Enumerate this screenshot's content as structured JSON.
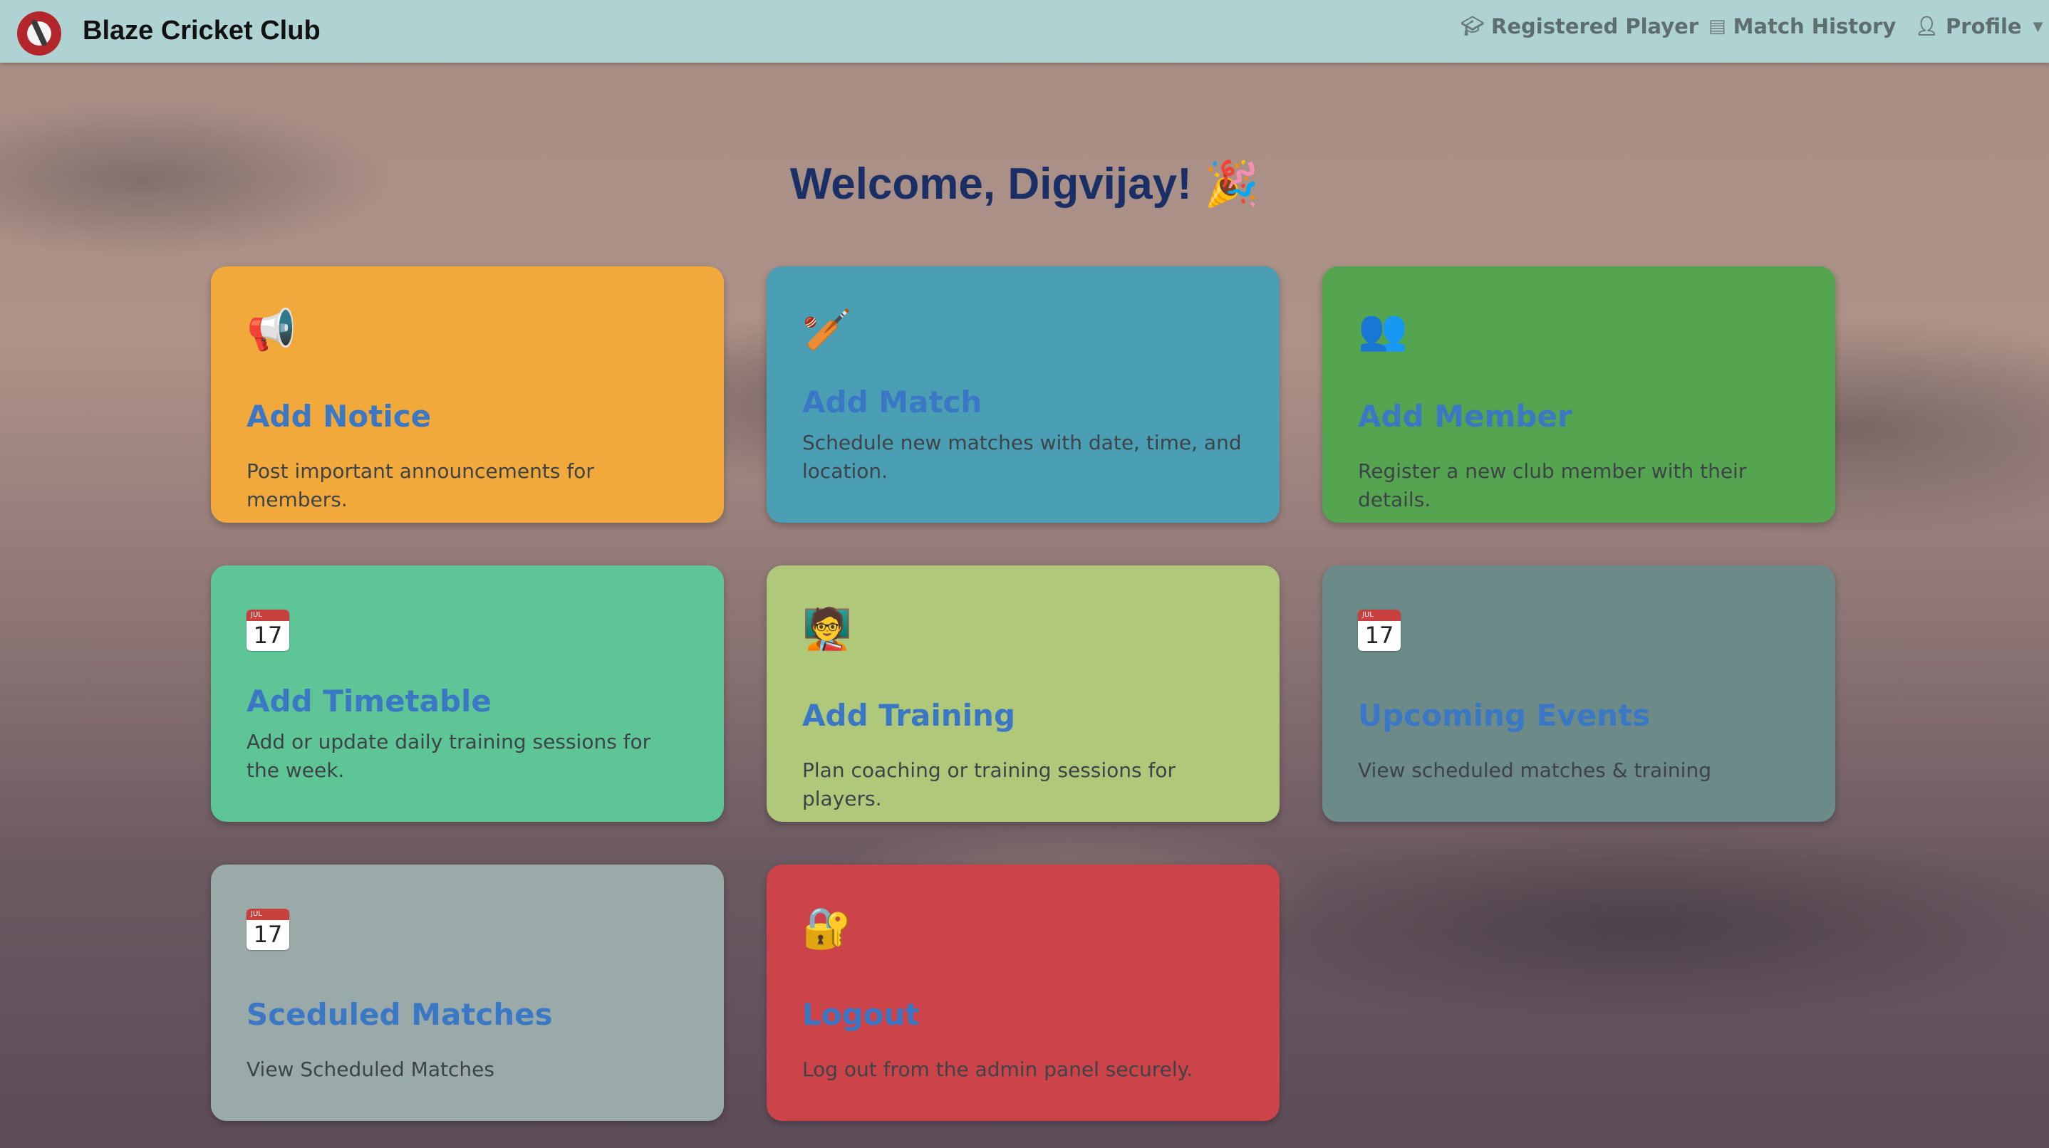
{
  "navbar": {
    "brand": "Blaze Cricket Club",
    "items": [
      {
        "label": "Registered Player",
        "icon": "graduation-cap-icon"
      },
      {
        "label": "Match History",
        "icon": "list-icon"
      },
      {
        "label": "Profile",
        "icon": "user-icon"
      }
    ]
  },
  "welcome": "Welcome, Digvijay! 🎉",
  "cards": [
    {
      "title": "Add Notice",
      "desc": "Post important announcements for members.",
      "icon": "megaphone-icon",
      "color": "#f1a93b"
    },
    {
      "title": "Add Match",
      "desc": "Schedule new matches with date, time, and location.",
      "icon": "cricket-bat-icon",
      "color": "#4a9fb4"
    },
    {
      "title": "Add Member",
      "desc": "Register a new club member with their details.",
      "icon": "users-icon",
      "color": "#55a550"
    },
    {
      "title": "Add Timetable",
      "desc": "Add or update daily training sessions for the week.",
      "icon": "calendar-icon",
      "calendar_day": "17",
      "calendar_month": "JUL",
      "color": "#5ec596"
    },
    {
      "title": "Add Training",
      "desc": "Plan coaching or training sessions for players.",
      "icon": "teacher-icon",
      "color": "#b0c87a"
    },
    {
      "title": "Upcoming Events",
      "desc": "View scheduled matches & training",
      "icon": "calendar-icon",
      "calendar_day": "17",
      "calendar_month": "JUL",
      "color": "#6b8a88"
    },
    {
      "title": "Sceduled Matches",
      "desc": "View Scheduled Matches",
      "icon": "calendar-icon",
      "calendar_day": "17",
      "calendar_month": "JUL",
      "color": "#9aaaa9"
    },
    {
      "title": "Logout",
      "desc": "Log out from the admin panel securely.",
      "icon": "lock-key-icon",
      "color": "#cc434a"
    }
  ]
}
